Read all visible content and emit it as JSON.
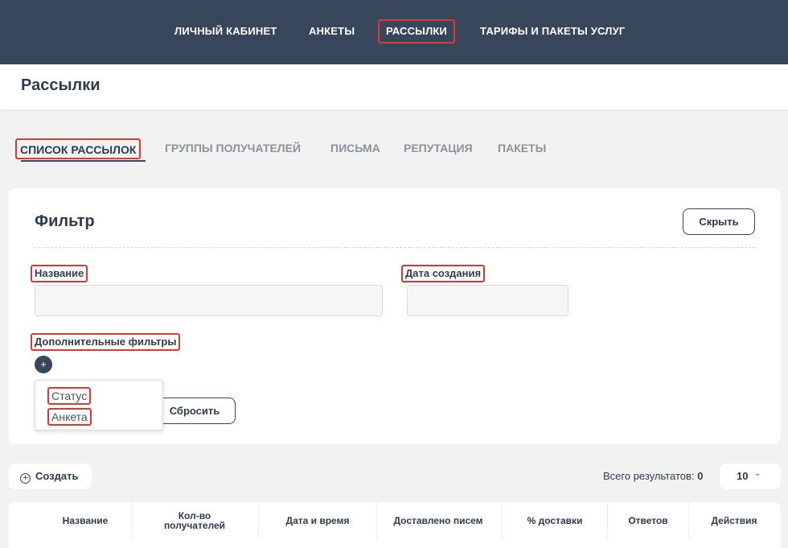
{
  "topnav": {
    "items": [
      "ЛИЧНЫЙ КАБИНЕТ",
      "АНКЕТЫ",
      "РАССЫЛКИ",
      "ТАРИФЫ И ПАКЕТЫ УСЛУГ"
    ],
    "active": "РАССЫЛКИ"
  },
  "page": {
    "title": "Рассылки"
  },
  "subtabs": {
    "items": [
      "СПИСОК РАССЫЛОК",
      "ГРУППЫ ПОЛУЧАТЕЛЕЙ",
      "ПИСЬМА",
      "РЕПУТАЦИЯ",
      "ПАКЕТЫ"
    ],
    "active": "СПИСОК РАССЫЛОК"
  },
  "filter": {
    "title": "Фильтр",
    "hide_label": "Скрыть",
    "name_label": "Название",
    "name_value": "",
    "date_label": "Дата создания",
    "date_value": "",
    "extra_label": "Дополнительные фильтры",
    "add_icon": "plus-icon",
    "reset_label": "Сбросить",
    "dropdown_options": [
      "Статус",
      "Анкета"
    ]
  },
  "toolbar": {
    "create_label": "Создать",
    "create_icon": "plus-circle-icon",
    "total_label": "Всего результатов:",
    "total_count": "0",
    "page_size": "10",
    "page_size_icon": "chevron-down-icon"
  },
  "table": {
    "columns": [
      "Название",
      "Кол-во получателей",
      "Дата и время",
      "Доставлено писем",
      "% доставки",
      "Ответов",
      "Действия"
    ]
  },
  "colors": {
    "nav_bg": "#38465b",
    "highlight": "#d93a35",
    "text_dark": "#2f3b4c",
    "accent_green": "#3a9a5b"
  }
}
